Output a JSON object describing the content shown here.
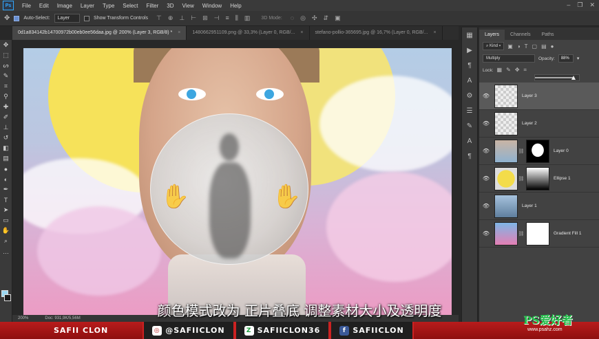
{
  "menu": {
    "logo": "Ps",
    "items": [
      "File",
      "Edit",
      "Image",
      "Layer",
      "Type",
      "Select",
      "Filter",
      "3D",
      "View",
      "Window",
      "Help"
    ]
  },
  "options": {
    "auto_select_label": "Auto-Select:",
    "auto_select_target": "Layer",
    "transform_label": "Show Transform Controls",
    "mode3d": "3D Mode:"
  },
  "tabs": [
    {
      "label": "0d1a834142b14700972b00eb0ee56daa.jpg @ 200% (Layer 3, RGB/8) *",
      "active": true
    },
    {
      "label": "1480662951109.png @ 33,3% (Layer 0, RGB/...",
      "active": false
    },
    {
      "label": "stefano-pollio-365695.jpg @ 16,7% (Layer 0, RGB/...",
      "active": false
    }
  ],
  "status": {
    "zoom": "200%",
    "doc": "Doc: 931,9K/5,56M"
  },
  "panel": {
    "tabs": [
      "Layers",
      "Channels",
      "Paths"
    ],
    "filter": "Kind",
    "blend_mode": "Multiply",
    "opacity_label": "Opacity:",
    "opacity_value": "88%",
    "opacity_fraction": 0.88,
    "lock_label": "Lock:",
    "layers": [
      {
        "name": "Layer 3",
        "selected": true
      },
      {
        "name": "Layer 2",
        "selected": false
      },
      {
        "name": "Layer 0",
        "selected": false
      },
      {
        "name": "Ellipse 1",
        "selected": false
      },
      {
        "name": "Layer 1",
        "selected": false
      },
      {
        "name": "Gradient Fill 1",
        "selected": false
      }
    ]
  },
  "subtitle": "颜色模式改为 正片叠底 调整素材大小及透明度",
  "banner": {
    "items": [
      "SAFII CLON",
      "@SAFIICLON",
      "SAFIICLON36",
      "SAFIICLON"
    ]
  },
  "watermark": {
    "logo_text": "PS爱好者",
    "url": "www.psahz.com"
  }
}
